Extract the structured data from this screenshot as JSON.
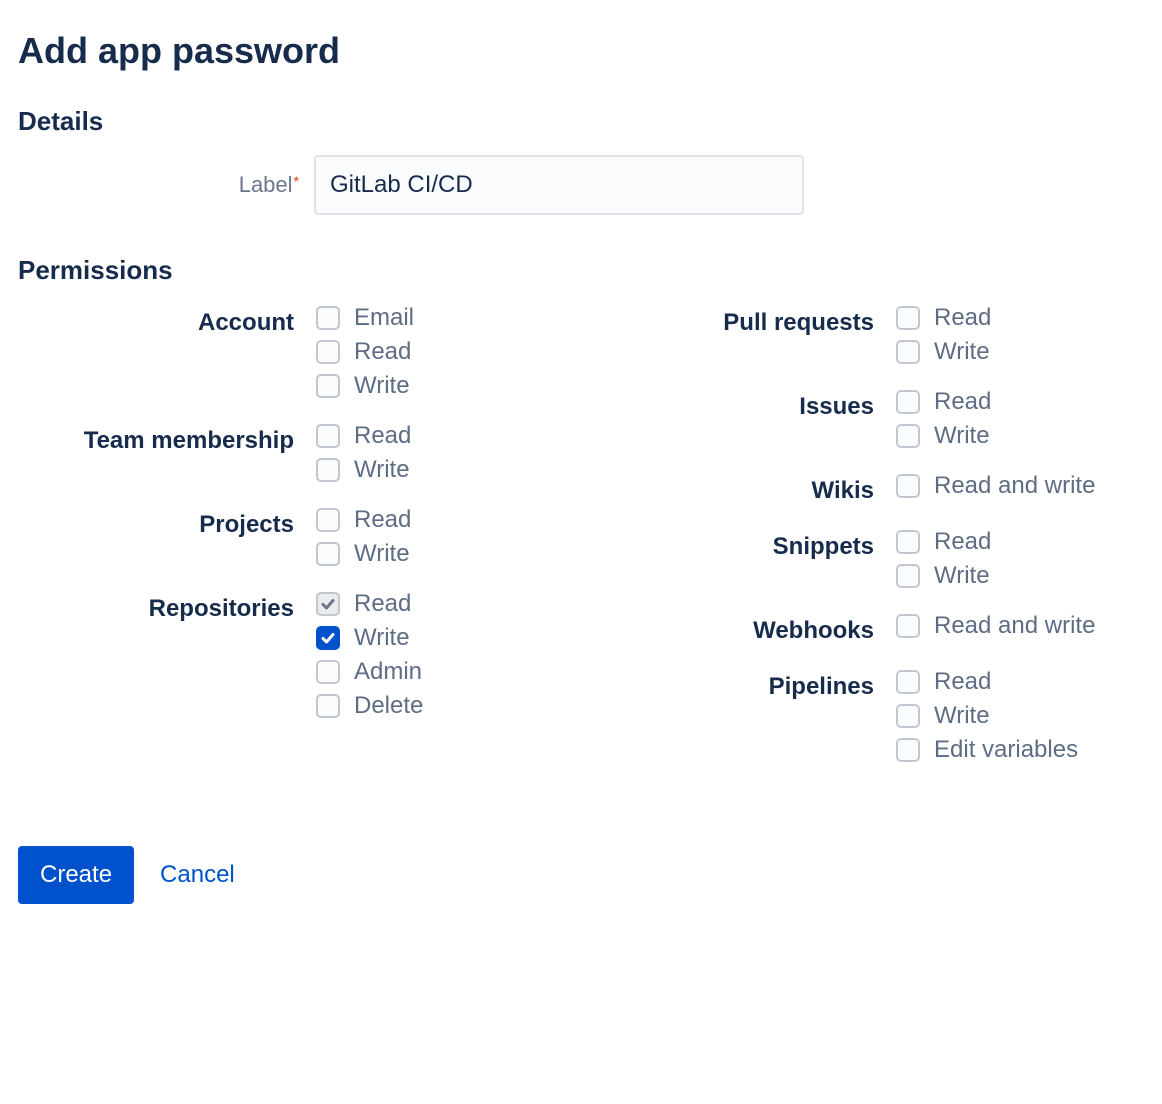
{
  "page_title": "Add app password",
  "details": {
    "section_title": "Details",
    "label_field": {
      "label": "Label",
      "required_marker": "*",
      "value": "GitLab CI/CD"
    }
  },
  "permissions": {
    "section_title": "Permissions",
    "left": [
      {
        "name": "Account",
        "options": [
          {
            "label": "Email",
            "checked": false,
            "disabled": false
          },
          {
            "label": "Read",
            "checked": false,
            "disabled": false
          },
          {
            "label": "Write",
            "checked": false,
            "disabled": false
          }
        ]
      },
      {
        "name": "Team membership",
        "options": [
          {
            "label": "Read",
            "checked": false,
            "disabled": false
          },
          {
            "label": "Write",
            "checked": false,
            "disabled": false
          }
        ]
      },
      {
        "name": "Projects",
        "options": [
          {
            "label": "Read",
            "checked": false,
            "disabled": false
          },
          {
            "label": "Write",
            "checked": false,
            "disabled": false
          }
        ]
      },
      {
        "name": "Repositories",
        "options": [
          {
            "label": "Read",
            "checked": true,
            "disabled": true
          },
          {
            "label": "Write",
            "checked": true,
            "disabled": false
          },
          {
            "label": "Admin",
            "checked": false,
            "disabled": false
          },
          {
            "label": "Delete",
            "checked": false,
            "disabled": false
          }
        ]
      }
    ],
    "right": [
      {
        "name": "Pull requests",
        "options": [
          {
            "label": "Read",
            "checked": false,
            "disabled": false
          },
          {
            "label": "Write",
            "checked": false,
            "disabled": false
          }
        ]
      },
      {
        "name": "Issues",
        "options": [
          {
            "label": "Read",
            "checked": false,
            "disabled": false
          },
          {
            "label": "Write",
            "checked": false,
            "disabled": false
          }
        ]
      },
      {
        "name": "Wikis",
        "options": [
          {
            "label": "Read and write",
            "checked": false,
            "disabled": false
          }
        ]
      },
      {
        "name": "Snippets",
        "options": [
          {
            "label": "Read",
            "checked": false,
            "disabled": false
          },
          {
            "label": "Write",
            "checked": false,
            "disabled": false
          }
        ]
      },
      {
        "name": "Webhooks",
        "options": [
          {
            "label": "Read and write",
            "checked": false,
            "disabled": false
          }
        ]
      },
      {
        "name": "Pipelines",
        "options": [
          {
            "label": "Read",
            "checked": false,
            "disabled": false
          },
          {
            "label": "Write",
            "checked": false,
            "disabled": false
          },
          {
            "label": "Edit variables",
            "checked": false,
            "disabled": false
          }
        ]
      }
    ]
  },
  "footer": {
    "create_label": "Create",
    "cancel_label": "Cancel"
  }
}
